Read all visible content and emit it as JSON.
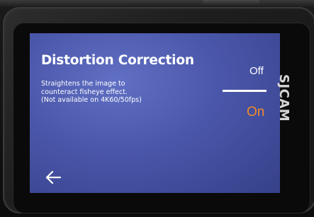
{
  "setting": {
    "title": "Distortion Correction",
    "description": [
      "Straightens the image to",
      "counteract fisheye effect.",
      "(Not available on 4K60/50fps)"
    ]
  },
  "options": {
    "off_label": "Off",
    "on_label": "On",
    "selected": "On"
  },
  "back_icon": "left-arrow-icon",
  "brand": "SJCAM",
  "colors": {
    "screen": "#4a56a9",
    "selected_option": "#f08a2c",
    "text": "#ffffff"
  }
}
